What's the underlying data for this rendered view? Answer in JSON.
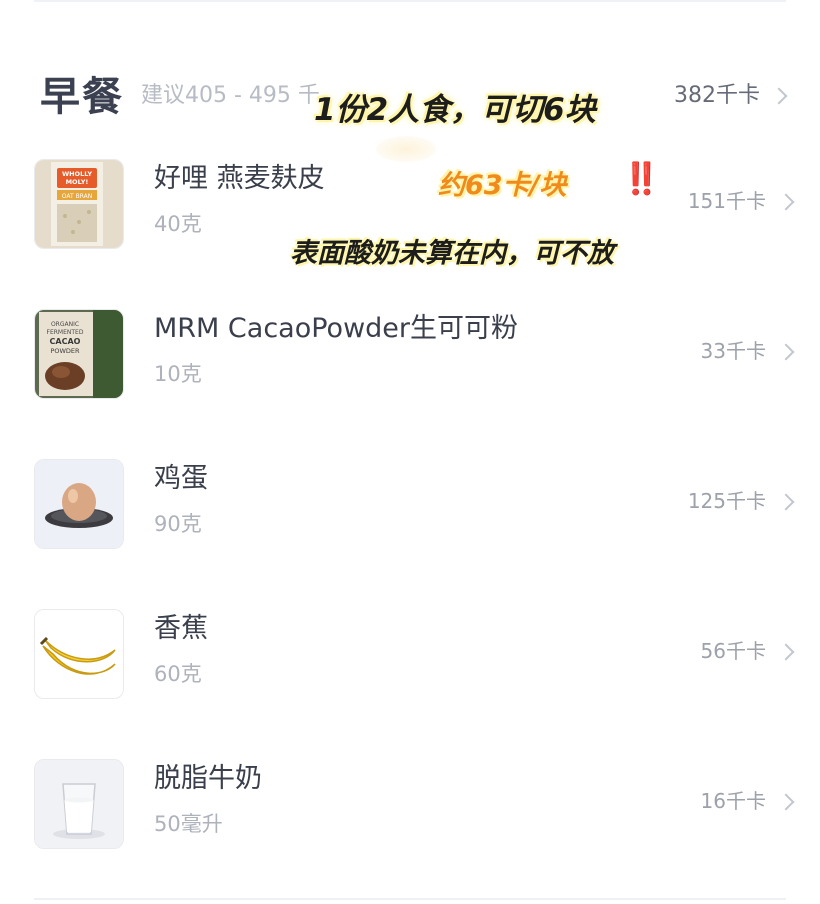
{
  "meal": {
    "title": "早餐",
    "suggestion": "建议405 - 495 千",
    "total": "382千卡"
  },
  "overlays": {
    "portion_note": "1份2人食，可切6块",
    "per_piece": "约63卡/块",
    "exclaim": "‼️",
    "yogurt_note": "表面酸奶未算在内，可不放"
  },
  "foods": [
    {
      "name": "好哩 燕麦麸皮",
      "amount": "40克",
      "kcal": "151千卡",
      "icon": "oat-bran-package-icon",
      "thumb_label": "WHOLLY MOLY! OAT BRAN"
    },
    {
      "name": "MRM CacaoPowder生可可粉",
      "amount": "10克",
      "kcal": "33千卡",
      "icon": "cacao-powder-package-icon",
      "thumb_label": "ORGANIC FERMENTED CACAO POWDER"
    },
    {
      "name": "鸡蛋",
      "amount": "90克",
      "kcal": "125千卡",
      "icon": "egg-icon"
    },
    {
      "name": "香蕉",
      "amount": "60克",
      "kcal": "56千卡",
      "icon": "banana-icon"
    },
    {
      "name": "脱脂牛奶",
      "amount": "50毫升",
      "kcal": "16千卡",
      "icon": "milk-glass-icon"
    }
  ],
  "colors": {
    "title": "#3b4150",
    "muted": "#aeb2bb",
    "overlay_orange": "#f08a1d",
    "overlay_red": "#e8312c"
  }
}
